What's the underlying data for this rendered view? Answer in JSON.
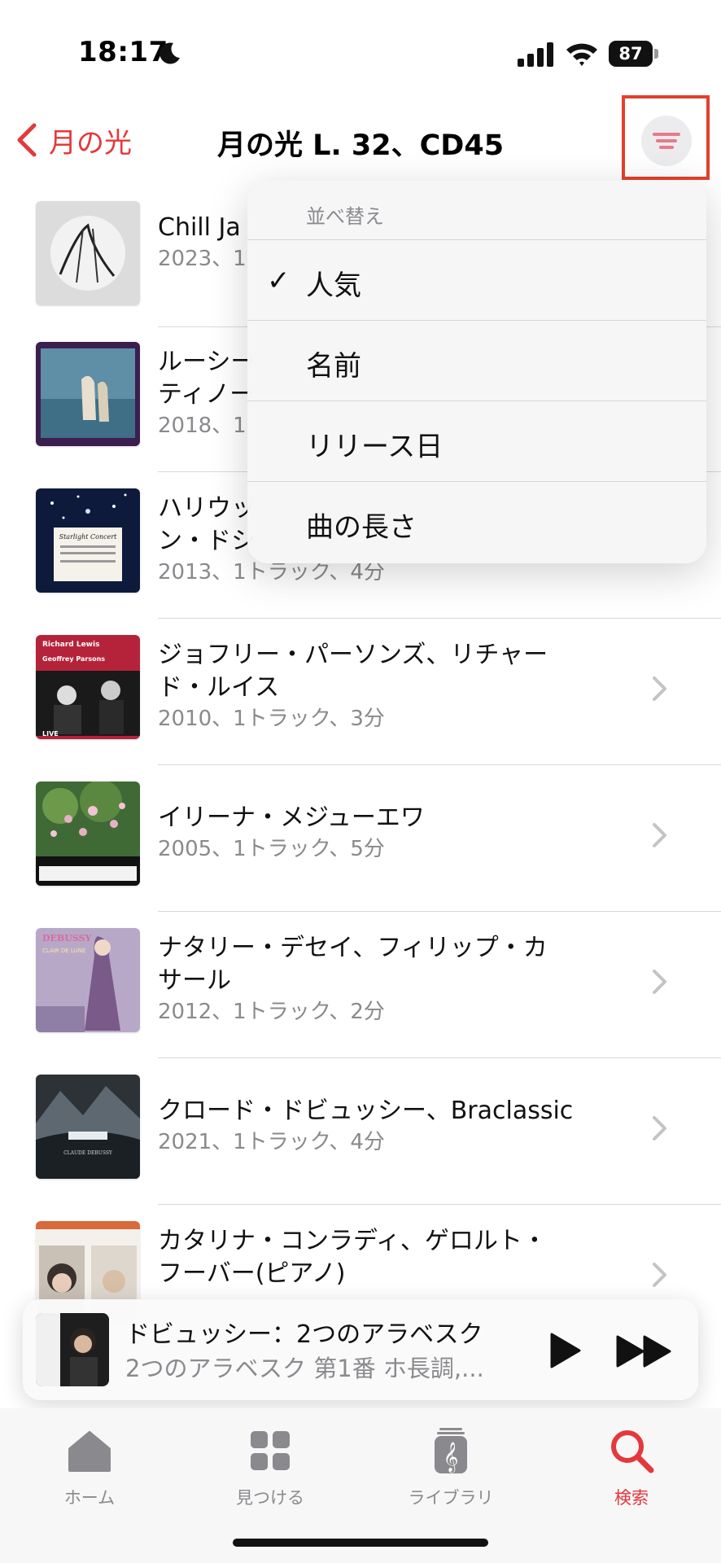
{
  "status_bar": {
    "time": "18:17",
    "battery": "87"
  },
  "nav": {
    "back_label": "月の光",
    "title": "月の光 L. 32、CD45"
  },
  "rows": [
    {
      "title": "Chill Ja",
      "subtitle": "2023、1"
    },
    {
      "title": "ルーシー",
      "title2": "ティノー",
      "subtitle": "2018、1"
    },
    {
      "title": "ハリウッ",
      "title2": "ン・ドシ",
      "subtitle": "2013、1トラック、4分"
    },
    {
      "title": "ジョフリー・パーソンズ、リチャー",
      "title2": "ド・ルイス",
      "subtitle": "2010、1トラック、3分"
    },
    {
      "title": "イリーナ・メジューエワ",
      "subtitle": "2005、1トラック、5分"
    },
    {
      "title": "ナタリー・デセイ、フィリップ・カ",
      "title2": "サール",
      "subtitle": "2012、1トラック、2分"
    },
    {
      "title": "クロード・ドビュッシー、Braclassic",
      "subtitle": "2021、1トラック、4分"
    },
    {
      "title": "カタリナ・コンラディ、ゲロルト・",
      "title2": "フーバー(ピアノ)"
    }
  ],
  "art_text": {
    "row3_a": "Starlight Concert",
    "row4_a": "Richard Lewis",
    "row4_b": "Geoffrey Parsons",
    "row4_c": "LIVE",
    "row6_a": "DEBUSSY",
    "row6_b": "CLAIR DE LUNE",
    "row7_a": "CLAUDE DEBUSSY"
  },
  "sort_menu": {
    "header": "並べ替え",
    "items": [
      "人気",
      "名前",
      "リリース日",
      "曲の長さ"
    ],
    "selected": "人気",
    "check": "✓"
  },
  "mini_player": {
    "title": "ドビュッシー：2つのアラベスク",
    "subtitle": "2つのアラベスク 第1番 ホ長調,..."
  },
  "tabs": [
    {
      "label": "ホーム",
      "icon": "house-icon"
    },
    {
      "label": "見つける",
      "icon": "grid-icon"
    },
    {
      "label": "ライブラリ",
      "icon": "music-library-icon"
    },
    {
      "label": "検索",
      "icon": "search-icon"
    }
  ],
  "colors": {
    "accent": "#e5383b",
    "highlight_box": "#e2412c",
    "secondary_text": "#8a8a8e"
  }
}
